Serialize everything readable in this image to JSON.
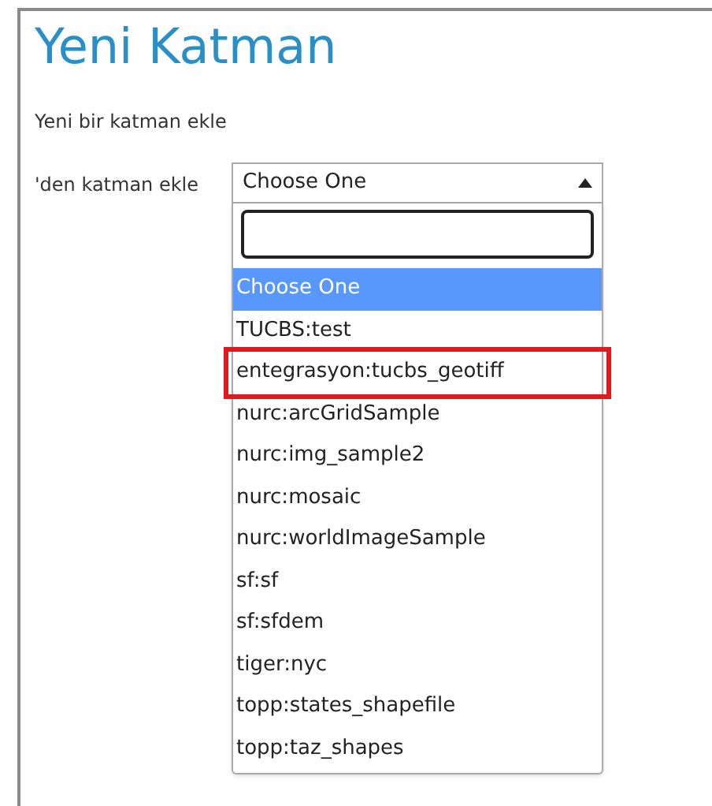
{
  "title": "Yeni Katman",
  "subtitle": "Yeni bir katman ekle",
  "field_label": "'den katman ekle",
  "dropdown": {
    "value": "Choose One",
    "expanded": true,
    "options": [
      {
        "label": "Choose One",
        "selected": true,
        "marked": false
      },
      {
        "label": "TUCBS:test",
        "selected": false,
        "marked": false
      },
      {
        "label": "entegrasyon:tucbs_geotiff",
        "selected": false,
        "marked": true
      },
      {
        "label": "nurc:arcGridSample",
        "selected": false,
        "marked": false
      },
      {
        "label": "nurc:img_sample2",
        "selected": false,
        "marked": false
      },
      {
        "label": "nurc:mosaic",
        "selected": false,
        "marked": false
      },
      {
        "label": "nurc:worldImageSample",
        "selected": false,
        "marked": false
      },
      {
        "label": "sf:sf",
        "selected": false,
        "marked": false
      },
      {
        "label": "sf:sfdem",
        "selected": false,
        "marked": false
      },
      {
        "label": "tiger:nyc",
        "selected": false,
        "marked": false
      },
      {
        "label": "topp:states_shapefile",
        "selected": false,
        "marked": false
      },
      {
        "label": "topp:taz_shapes",
        "selected": false,
        "marked": false
      }
    ]
  }
}
